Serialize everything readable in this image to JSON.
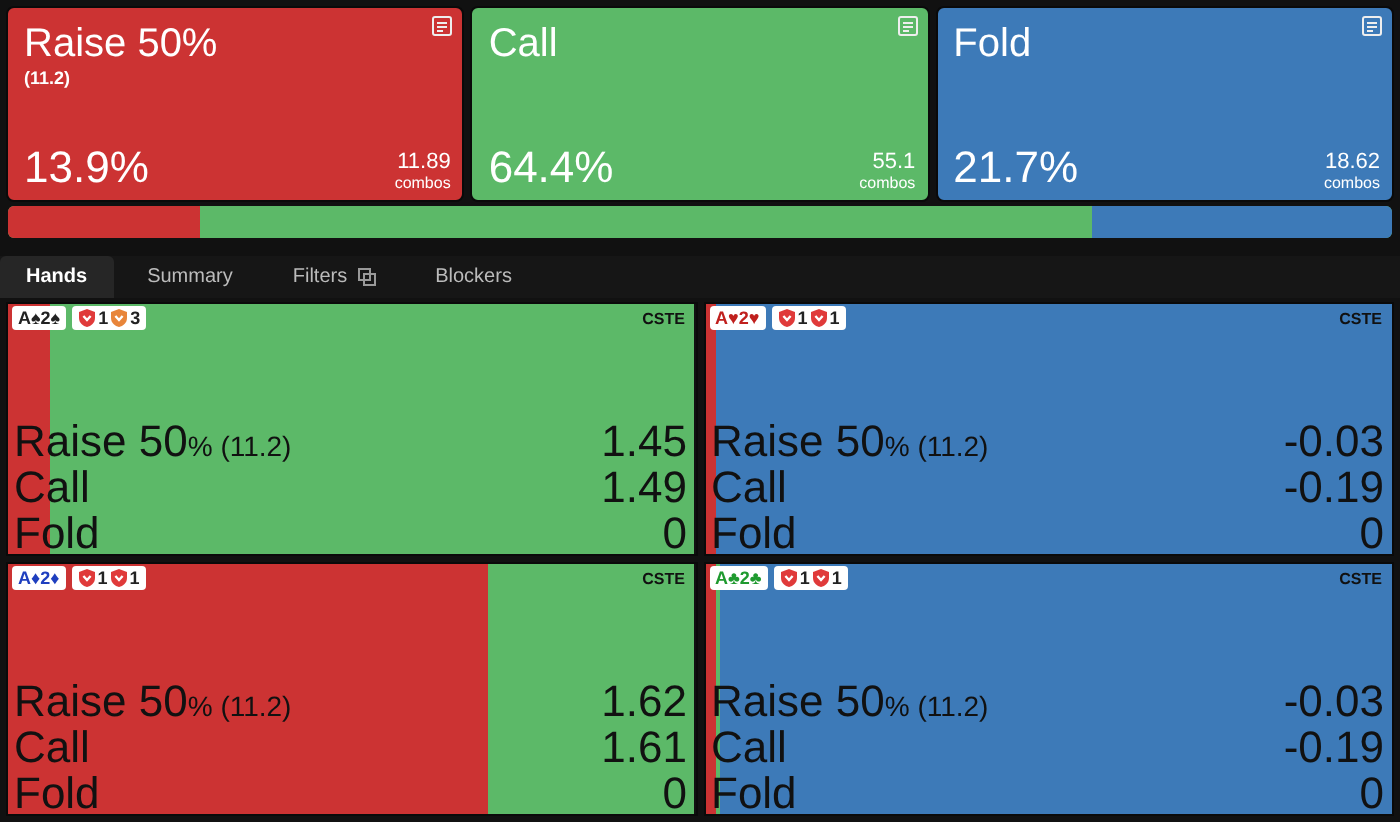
{
  "actions": [
    {
      "title": "Raise 50%",
      "sizing": "(11.2)",
      "percent": "13.9%",
      "combos": "11.89",
      "combos_label": "combos",
      "color": "#cc3333"
    },
    {
      "title": "Call",
      "percent": "64.4%",
      "combos": "55.1",
      "combos_label": "combos",
      "color": "#5cb968"
    },
    {
      "title": "Fold",
      "percent": "21.7%",
      "combos": "18.62",
      "combos_label": "combos",
      "color": "#3d7ab8"
    }
  ],
  "frequency_bar": [
    {
      "kind": "raise",
      "level": 0.139
    },
    {
      "kind": "fold",
      "level": 0.217
    }
  ],
  "tabs": [
    {
      "label": "Hands",
      "selected": true
    },
    {
      "label": "Summary",
      "selected": false
    },
    {
      "label": "Filters",
      "selected": false,
      "icon": true
    },
    {
      "label": "Blockers",
      "selected": false
    }
  ],
  "hands": [
    {
      "cards": "A♠2♠",
      "color": "#222222",
      "blockers": [
        {
          "value": "1",
          "color": "#e03a3a"
        },
        {
          "value": "3",
          "color": "#e8853a"
        }
      ],
      "tag": "CSTE",
      "mix": [
        {
          "kind": "raise",
          "level": 0.06
        },
        {
          "kind": "call",
          "level": 0.94
        }
      ],
      "rows": [
        {
          "label": "Raise 50",
          "unit": "%",
          "sizing": "(11.2)",
          "ev": "1.45"
        },
        {
          "label": "Call",
          "ev": "1.49"
        },
        {
          "label": "Fold",
          "ev": "0"
        }
      ]
    },
    {
      "cards": "A♥2♥",
      "color": "#c0201e",
      "blockers": [
        {
          "value": "1",
          "color": "#e03a3a"
        },
        {
          "value": "1",
          "color": "#e03a3a"
        }
      ],
      "tag": "CSTE",
      "mix": [
        {
          "kind": "raise",
          "level": 0.015
        },
        {
          "kind": "fold",
          "level": 0.985
        }
      ],
      "rows": [
        {
          "label": "Raise 50",
          "unit": "%",
          "sizing": "(11.2)",
          "ev": "-0.03"
        },
        {
          "label": "Call",
          "ev": "-0.19"
        },
        {
          "label": "Fold",
          "ev": "0"
        }
      ]
    },
    {
      "cards": "A♦2♦",
      "color": "#1f3fbf",
      "blockers": [
        {
          "value": "1",
          "color": "#e03a3a"
        },
        {
          "value": "1",
          "color": "#e03a3a"
        }
      ],
      "tag": "CSTE",
      "mix": [
        {
          "kind": "raise",
          "level": 0.7
        },
        {
          "kind": "call",
          "level": 0.3
        }
      ],
      "rows": [
        {
          "label": "Raise 50",
          "unit": "%",
          "sizing": "(11.2)",
          "ev": "1.62"
        },
        {
          "label": "Call",
          "ev": "1.61"
        },
        {
          "label": "Fold",
          "ev": "0"
        }
      ]
    },
    {
      "cards": "A♣2♣",
      "color": "#1f9a2f",
      "blockers": [
        {
          "value": "1",
          "color": "#e03a3a"
        },
        {
          "value": "1",
          "color": "#e03a3a"
        }
      ],
      "tag": "CSTE",
      "mix": [
        {
          "kind": "raise",
          "level": 0.015
        },
        {
          "kind": "call",
          "level": 0.006
        },
        {
          "kind": "fold",
          "level": 0.979
        }
      ],
      "rows": [
        {
          "label": "Raise 50",
          "unit": "%",
          "sizing": "(11.2)",
          "ev": "-0.03"
        },
        {
          "label": "Call",
          "ev": "-0.19"
        },
        {
          "label": "Fold",
          "ev": "0"
        }
      ]
    }
  ]
}
